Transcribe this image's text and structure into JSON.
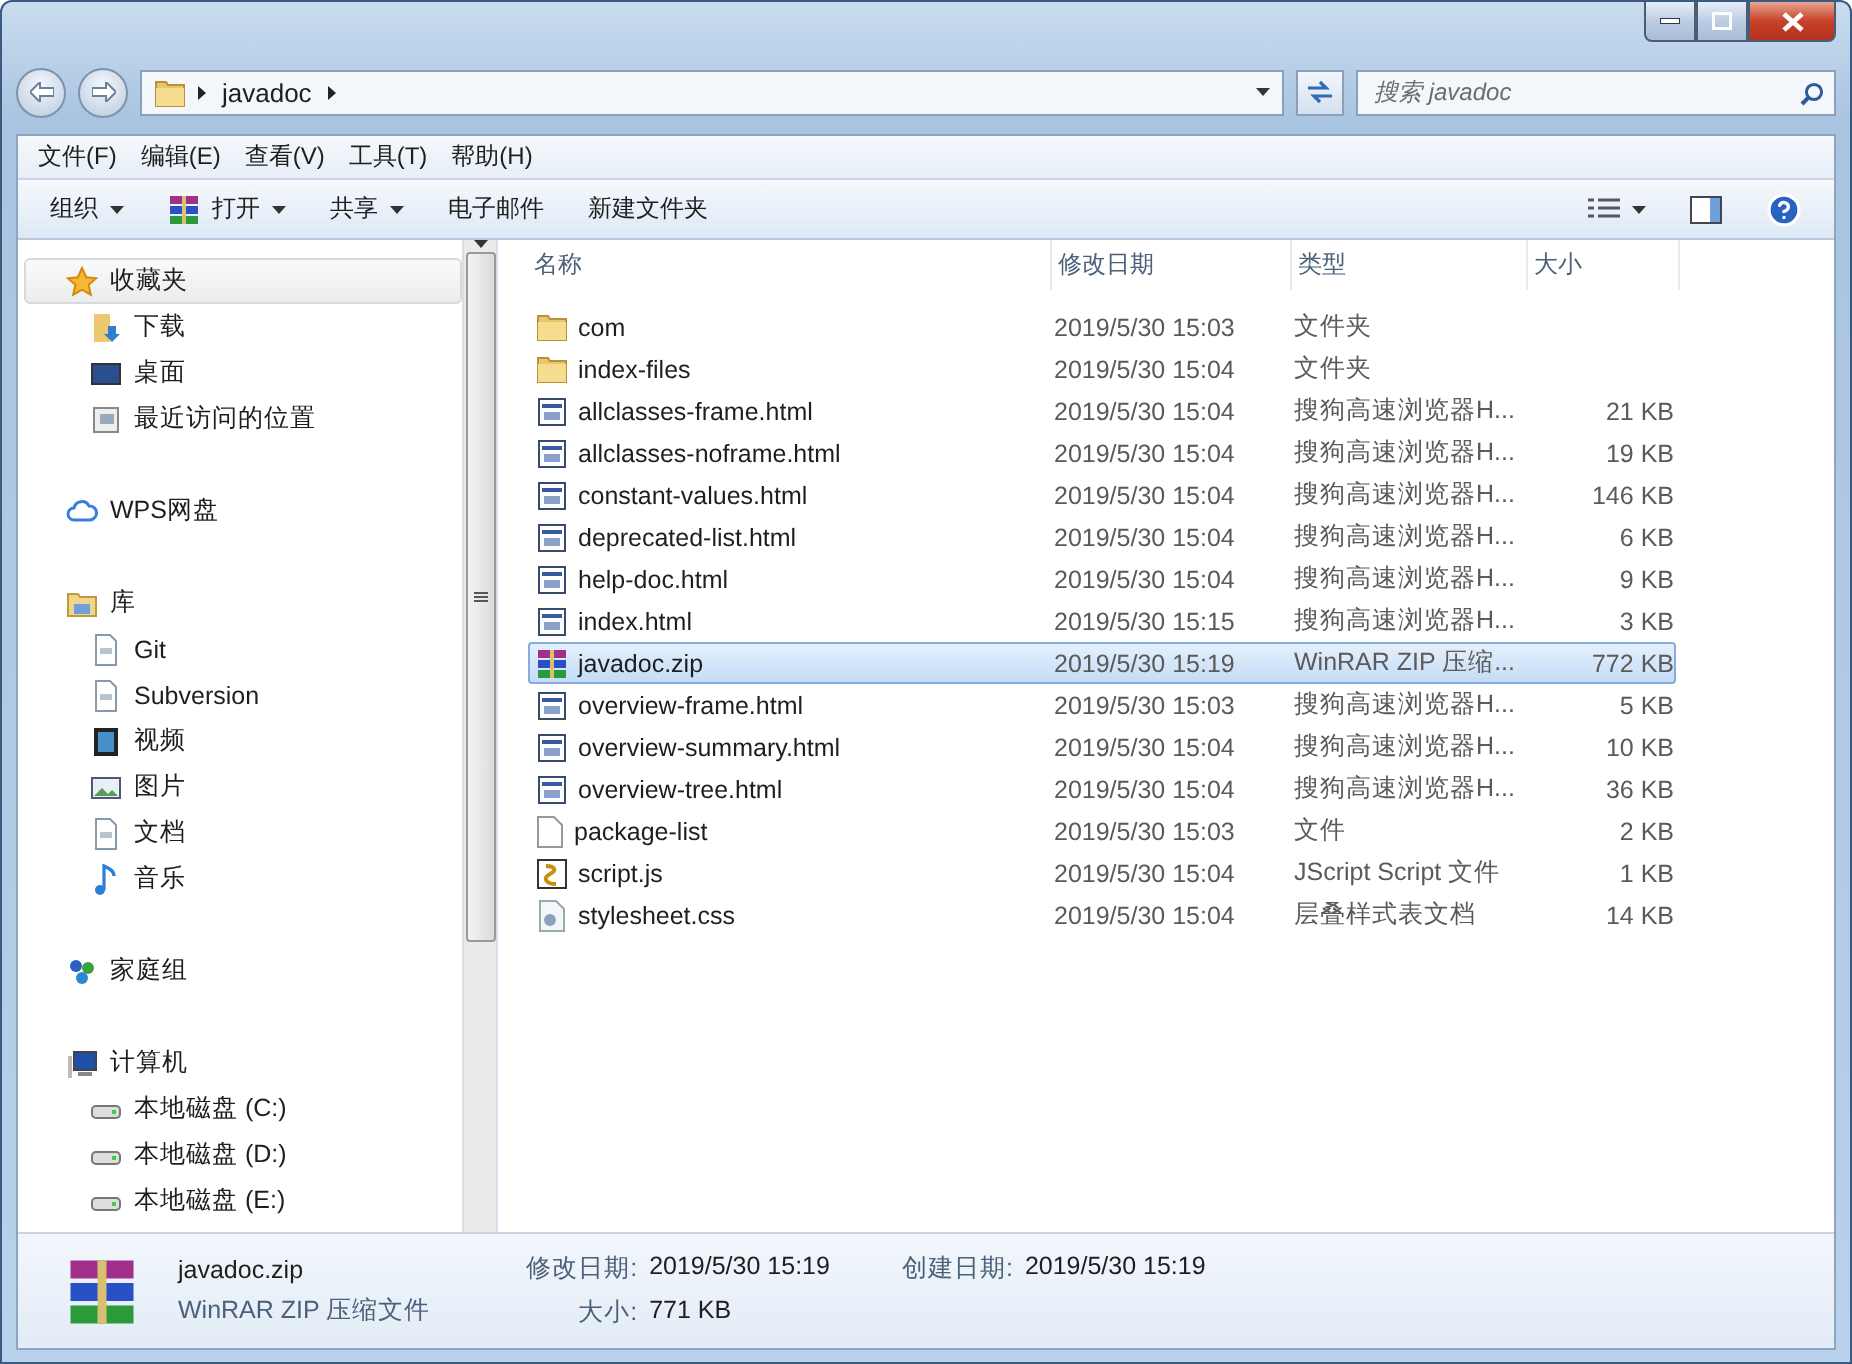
{
  "address": {
    "path": [
      "javadoc"
    ],
    "search_placeholder": "搜索 javadoc"
  },
  "menu": [
    "文件(F)",
    "编辑(E)",
    "查看(V)",
    "工具(T)",
    "帮助(H)"
  ],
  "toolbar": [
    {
      "label": "组织",
      "kind": "dropdown"
    },
    {
      "label": "打开",
      "kind": "open"
    },
    {
      "label": "共享",
      "kind": "dropdown"
    },
    {
      "label": "电子邮件",
      "kind": "plain"
    },
    {
      "label": "新建文件夹",
      "kind": "plain"
    }
  ],
  "sidebar": [
    {
      "label": "收藏夹",
      "kind": "star",
      "selected": true,
      "children": [
        {
          "label": "下载",
          "kind": "download"
        },
        {
          "label": "桌面",
          "kind": "desktop"
        },
        {
          "label": "最近访问的位置",
          "kind": "recent"
        }
      ]
    },
    {
      "label": "WPS网盘",
      "kind": "cloud",
      "selected": false
    },
    {
      "label": "库",
      "kind": "library",
      "selected": false,
      "children": [
        {
          "label": "Git",
          "kind": "doc"
        },
        {
          "label": "Subversion",
          "kind": "doc"
        },
        {
          "label": "视频",
          "kind": "video"
        },
        {
          "label": "图片",
          "kind": "picture"
        },
        {
          "label": "文档",
          "kind": "doc"
        },
        {
          "label": "音乐",
          "kind": "music"
        }
      ]
    },
    {
      "label": "家庭组",
      "kind": "homegroup",
      "selected": false
    },
    {
      "label": "计算机",
      "kind": "computer",
      "selected": false,
      "children": [
        {
          "label": "本地磁盘 (C:)",
          "kind": "drive"
        },
        {
          "label": "本地磁盘 (D:)",
          "kind": "drive"
        },
        {
          "label": "本地磁盘 (E:)",
          "kind": "drive"
        }
      ]
    }
  ],
  "table": {
    "columns": [
      "名称",
      "修改日期",
      "类型",
      "大小"
    ],
    "rows": [
      {
        "name": "com",
        "date": "2019/5/30 15:03",
        "type": "文件夹",
        "kind": "folder",
        "selected": false
      },
      {
        "name": "index-files",
        "date": "2019/5/30 15:04",
        "type": "文件夹",
        "kind": "folder",
        "selected": false
      },
      {
        "name": "allclasses-frame.html",
        "date": "2019/5/30 15:04",
        "type": "搜狗高速浏览器H...",
        "size": "21 KB",
        "kind": "html",
        "selected": false
      },
      {
        "name": "allclasses-noframe.html",
        "date": "2019/5/30 15:04",
        "type": "搜狗高速浏览器H...",
        "size": "19 KB",
        "kind": "html",
        "selected": false
      },
      {
        "name": "constant-values.html",
        "date": "2019/5/30 15:04",
        "type": "搜狗高速浏览器H...",
        "size": "146 KB",
        "kind": "html",
        "selected": false
      },
      {
        "name": "deprecated-list.html",
        "date": "2019/5/30 15:04",
        "type": "搜狗高速浏览器H...",
        "size": "6 KB",
        "kind": "html",
        "selected": false
      },
      {
        "name": "help-doc.html",
        "date": "2019/5/30 15:04",
        "type": "搜狗高速浏览器H...",
        "size": "9 KB",
        "kind": "html",
        "selected": false
      },
      {
        "name": "index.html",
        "date": "2019/5/30 15:15",
        "type": "搜狗高速浏览器H...",
        "size": "3 KB",
        "kind": "html",
        "selected": false
      },
      {
        "name": "javadoc.zip",
        "date": "2019/5/30 15:19",
        "type": "WinRAR ZIP 压缩...",
        "size": "772 KB",
        "kind": "zip",
        "selected": true
      },
      {
        "name": "overview-frame.html",
        "date": "2019/5/30 15:03",
        "type": "搜狗高速浏览器H...",
        "size": "5 KB",
        "kind": "html",
        "selected": false
      },
      {
        "name": "overview-summary.html",
        "date": "2019/5/30 15:04",
        "type": "搜狗高速浏览器H...",
        "size": "10 KB",
        "kind": "html",
        "selected": false
      },
      {
        "name": "overview-tree.html",
        "date": "2019/5/30 15:04",
        "type": "搜狗高速浏览器H...",
        "size": "36 KB",
        "kind": "html",
        "selected": false
      },
      {
        "name": "package-list",
        "date": "2019/5/30 15:03",
        "type": "文件",
        "size": "2 KB",
        "kind": "blank",
        "selected": false
      },
      {
        "name": "script.js",
        "date": "2019/5/30 15:04",
        "type": "JScript Script 文件",
        "size": "1 KB",
        "kind": "script",
        "selected": false
      },
      {
        "name": "stylesheet.css",
        "date": "2019/5/30 15:04",
        "type": "层叠样式表文档",
        "size": "14 KB",
        "kind": "css",
        "selected": false
      }
    ]
  },
  "details": {
    "name": "javadoc.zip",
    "type": "WinRAR ZIP 压缩文件",
    "fields": [
      {
        "label": "修改日期:",
        "value": "2019/5/30 15:19"
      },
      {
        "label": "创建日期:",
        "value": "2019/5/30 15:19"
      },
      {
        "label": "大小:",
        "value": "771 KB"
      }
    ]
  }
}
